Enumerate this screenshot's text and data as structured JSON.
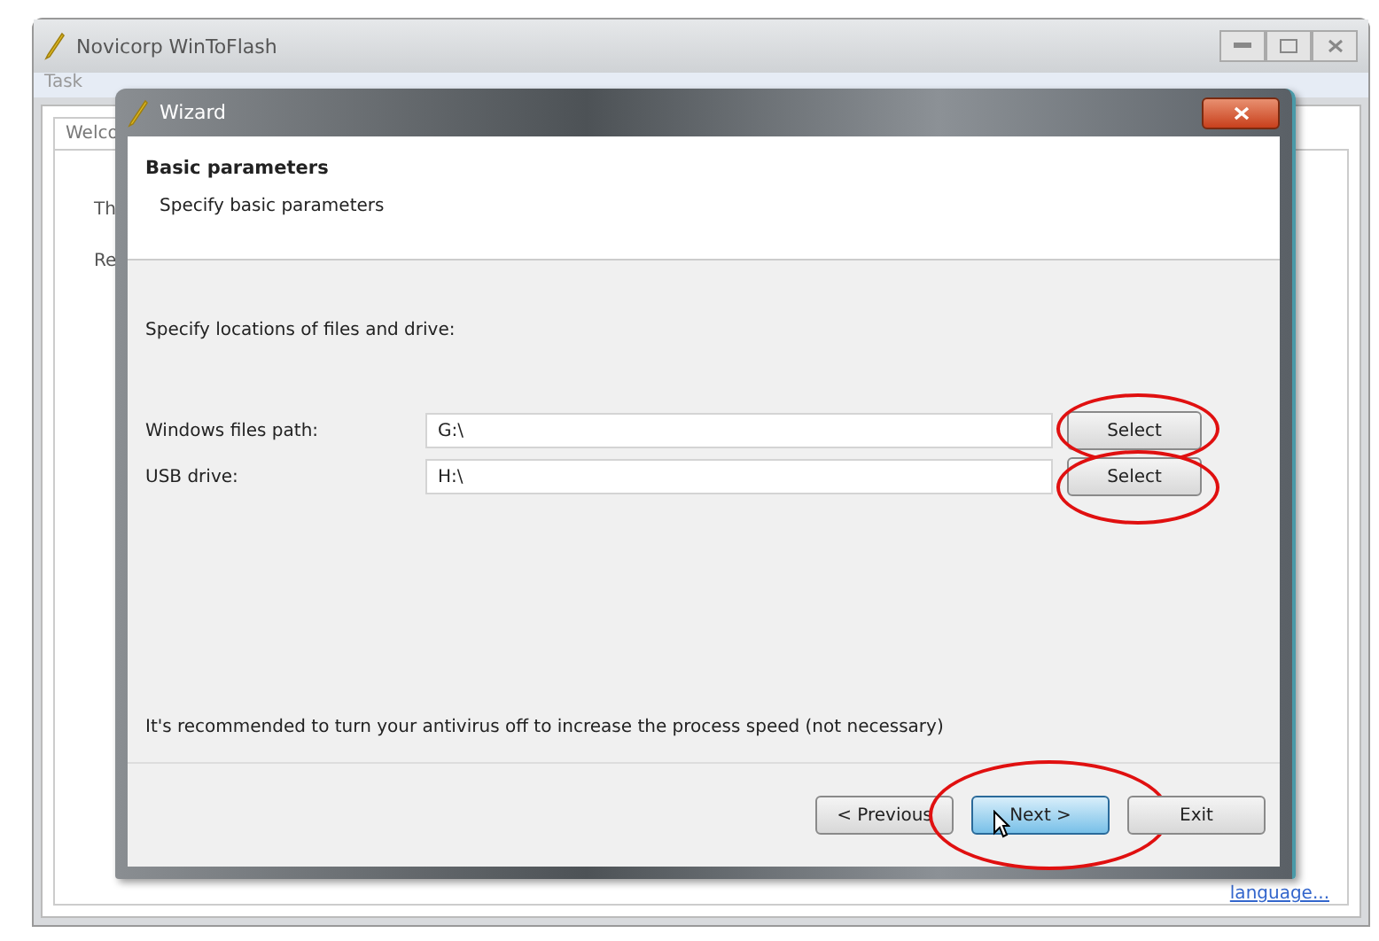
{
  "main_window": {
    "title": "Novicorp WinToFlash",
    "menu": [
      "Task"
    ],
    "tab": {
      "label": "Welco"
    },
    "texts": [
      "Th",
      "Re"
    ],
    "link": "language..."
  },
  "wizard": {
    "title": "Wizard",
    "header": {
      "title": "Basic parameters",
      "subtitle": "Specify basic parameters"
    },
    "instruction": "Specify locations of files and drive:",
    "fields": [
      {
        "label": "Windows files path:",
        "value": "G:\\",
        "button": "Select",
        "circled": true
      },
      {
        "label": "USB drive:",
        "value": "H:\\",
        "button": "Select",
        "circled": true
      }
    ],
    "note": "It's recommended to turn your antivirus off to increase the process speed (not necessary)",
    "buttons": [
      {
        "label": "< Previous",
        "default": false,
        "circled": false
      },
      {
        "label": "Next >",
        "default": true,
        "circled": true
      },
      {
        "label": "Exit",
        "default": false,
        "circled": false
      }
    ]
  }
}
